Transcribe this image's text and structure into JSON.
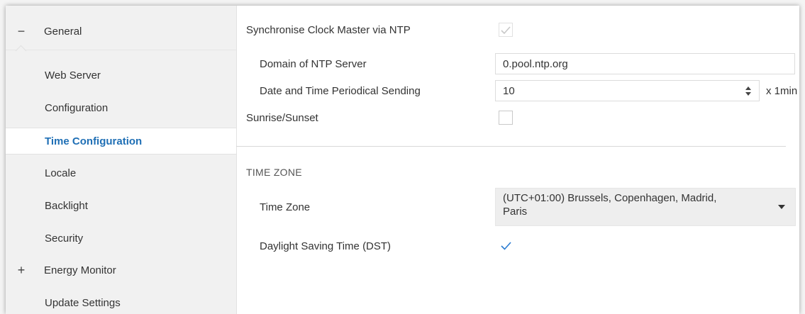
{
  "sidebar": {
    "group_general": {
      "toggle": "−",
      "label": "General"
    },
    "items": [
      {
        "label": "Web Server"
      },
      {
        "label": "Configuration"
      },
      {
        "label": "Time Configuration",
        "active": true
      },
      {
        "label": "Locale"
      },
      {
        "label": "Backlight"
      },
      {
        "label": "Security"
      }
    ],
    "group_energy": {
      "toggle": "+",
      "label": "Energy Monitor"
    },
    "update_settings": {
      "label": "Update Settings"
    }
  },
  "ntp": {
    "sync_label": "Synchronise Clock Master via NTP",
    "sync_checked": true,
    "domain_label": "Domain of NTP Server",
    "domain_value": "0.pool.ntp.org",
    "periodic_label": "Date and Time Periodical Sending",
    "periodic_value": "10",
    "periodic_unit": "x 1min",
    "sunrise_label": "Sunrise/Sunset",
    "sunrise_checked": false
  },
  "time_zone_section": {
    "title": "TIME ZONE",
    "tz_label": "Time Zone",
    "tz_value_line1": "(UTC+01:00) Brussels, Copenhagen, Madrid,",
    "tz_value_line2": "Paris",
    "dst_label": "Daylight Saving Time (DST)",
    "dst_checked": true
  },
  "colors": {
    "accent": "#1f6fb5",
    "checkmark": "#2a7bd1",
    "checkmark_disabled": "#c8c8c8"
  }
}
